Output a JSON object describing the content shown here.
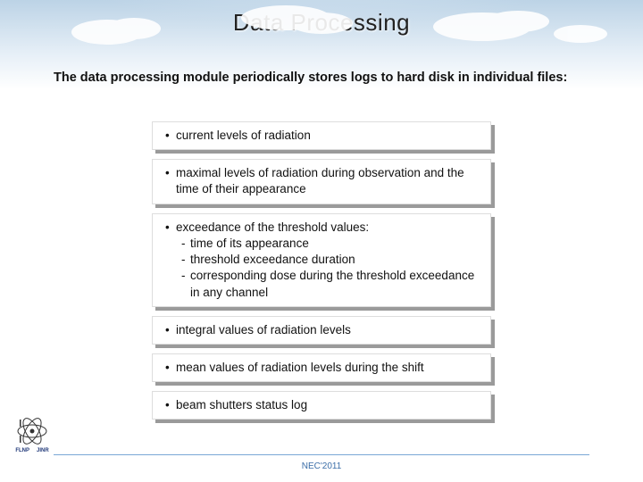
{
  "title": "Data Processing",
  "intro": "The data processing module periodically stores logs to hard disk in individual files:",
  "bullet": "•",
  "dash": "-",
  "boxes": [
    {
      "text": "current levels of radiation"
    },
    {
      "text": "maximal levels of radiation during observation and the time of their appearance"
    },
    {
      "text": "exceedance of the threshold values:",
      "sub": [
        "time of its appearance",
        "threshold exceedance duration",
        "corresponding dose during the threshold exceedance in any   channel"
      ]
    },
    {
      "text": "integral values of radiation levels"
    },
    {
      "text": "mean values of radiation levels during the shift"
    },
    {
      "text": "beam shutters status log"
    }
  ],
  "logo": {
    "left": "FLNP",
    "right": "JINR"
  },
  "footer": "NEC'2011",
  "colors": {
    "accent": "#3b6ea8"
  }
}
